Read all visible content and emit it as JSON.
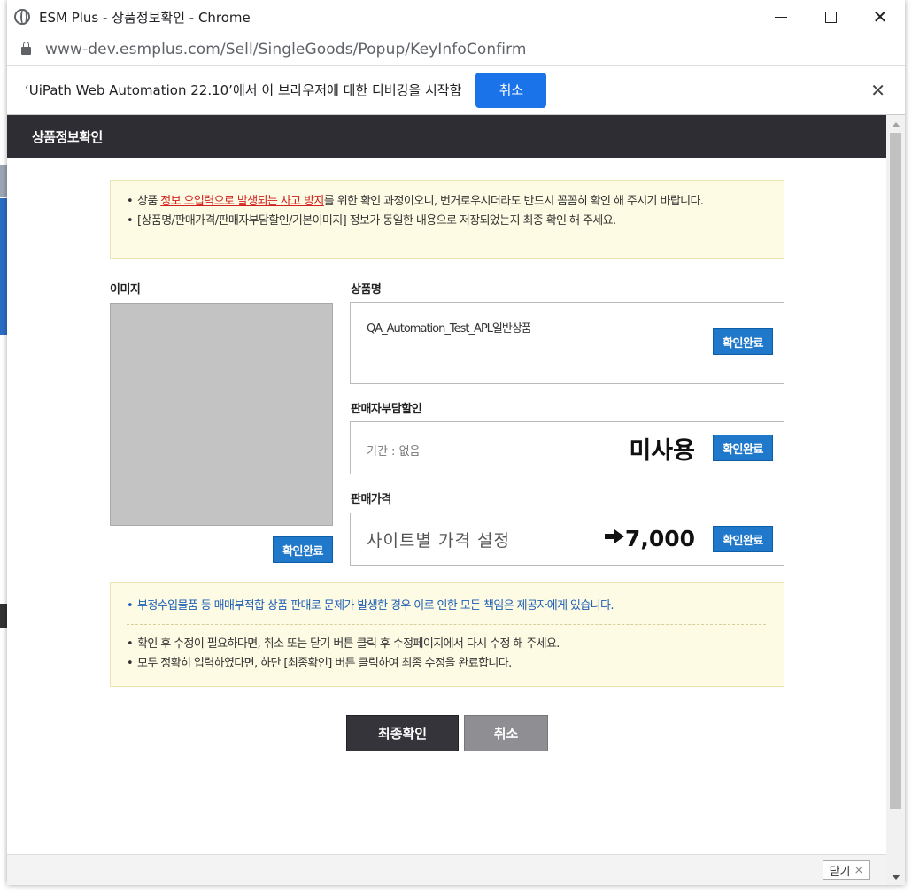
{
  "window": {
    "title": "ESM Plus - 상품정보확인 - Chrome",
    "url": "www-dev.esmplus.com/Sell/SingleGoods/Popup/KeyInfoConfirm"
  },
  "infobar": {
    "message": "‘UiPath Web Automation 22.10’에서 이 브라우저에 대한 디버깅을 시작함",
    "cancel_label": "취소",
    "close_glyph": "✕"
  },
  "popup": {
    "header_title": "상품정보확인"
  },
  "notice_top": {
    "line1_prefix": "상품 ",
    "line1_highlight": "정보 오입력으로 발생되는 사고 방지",
    "line1_suffix": "를 위한 확인 과정이오니, 번거로우시더라도 반드시 꼼꼼히 확인 해 주시기 바랍니다.",
    "line2": "[상품명/판매가격/판매자부담할인/기본이미지] 정보가 동일한 내용으로 저장되었는지 최종 확인 해 주세요."
  },
  "image_section": {
    "label": "이미지",
    "confirm_label": "확인완료"
  },
  "product_name": {
    "label": "상품명",
    "value": "QA_Automation_Test_APL일반상품",
    "confirm_label": "확인완료"
  },
  "seller_discount": {
    "label": "판매자부담할인",
    "period": "기간 : 없음",
    "status": "미사용",
    "confirm_label": "확인완료"
  },
  "sale_price": {
    "label": "판매가격",
    "site_label": "사이트별 가격 설정",
    "value": "7,000",
    "confirm_label": "확인완료"
  },
  "notice_bottom": {
    "warning": "부정수입물품 등 매매부적합 상품 판매로 문제가 발생한 경우 이로 인한 모든 책임은 제공자에게 있습니다.",
    "line1": "확인 후 수정이 필요하다면, 취소 또는 닫기 버튼 클릭 후 수정페이지에서 다시 수정 해 주세요.",
    "line2": "모두 정확히 입력하였다면, 하단 [최종확인] 버튼 클릭하여 최종 수정을 완료합니다."
  },
  "actions": {
    "final_confirm": "최종확인",
    "cancel": "취소"
  },
  "footer": {
    "close_label": "닫기",
    "close_x": "×"
  },
  "colors": {
    "header_bg": "#2d2d33",
    "confirm_blue": "#1f78c9",
    "chrome_blue": "#1a73e8",
    "notice_bg": "#fdfbe3",
    "highlight_red": "#d12020"
  }
}
